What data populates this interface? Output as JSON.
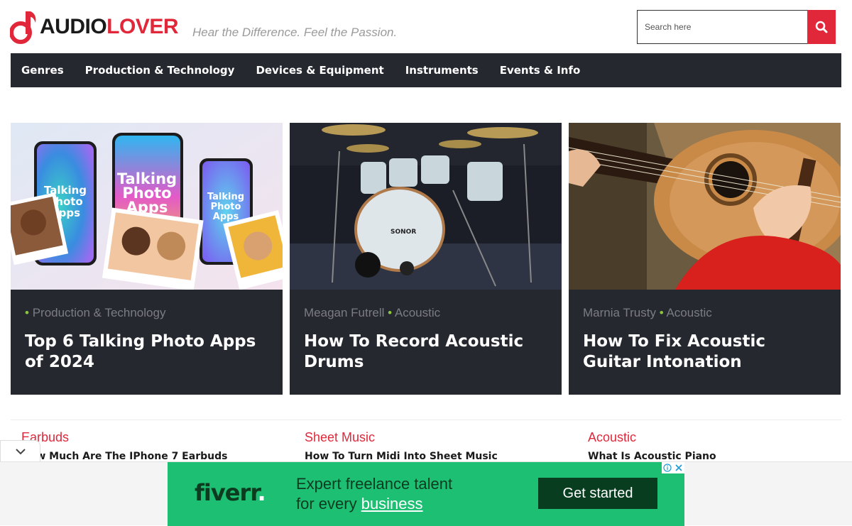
{
  "brand": {
    "name_part1": "AUDIO",
    "name_part2": "LOVER",
    "tagline": "Hear the Difference. Feel the Passion.",
    "accent_color": "#e0283a"
  },
  "search": {
    "placeholder": "Search here",
    "icon": "search-icon"
  },
  "nav": {
    "items": [
      {
        "label": "Genres"
      },
      {
        "label": "Production & Technology"
      },
      {
        "label": "Devices & Equipment"
      },
      {
        "label": "Instruments"
      },
      {
        "label": "Events & Info"
      }
    ]
  },
  "featured": [
    {
      "author": "",
      "category": "Production & Technology",
      "title": "Top 6 Talking Photo Apps of 2024",
      "image": "talking-photo-apps-illustration",
      "image_text": "Talking Photo Apps"
    },
    {
      "author": "Meagan Futrell",
      "category": "Acoustic",
      "title": "How To Record Acoustic Drums",
      "image": "drum-kit-photo",
      "image_text": "SONOR"
    },
    {
      "author": "Marnia Trusty",
      "category": "Acoustic",
      "title": "How To Fix Acoustic Guitar Intonation",
      "image": "acoustic-guitar-photo"
    }
  ],
  "lists": [
    {
      "category": "Earbuds",
      "title": "How Much Are The IPhone 7 Earbuds"
    },
    {
      "category": "Sheet Music",
      "title": "How To Turn Midi Into Sheet Music"
    },
    {
      "category": "Acoustic",
      "title": "What Is Acoustic Piano"
    }
  ],
  "ad": {
    "brand": "fiverr",
    "line1": "Expert freelance talent",
    "line2_prefix": "for every ",
    "line2_link": "business",
    "cta": "Get started",
    "bg_color": "#1dbf73"
  }
}
